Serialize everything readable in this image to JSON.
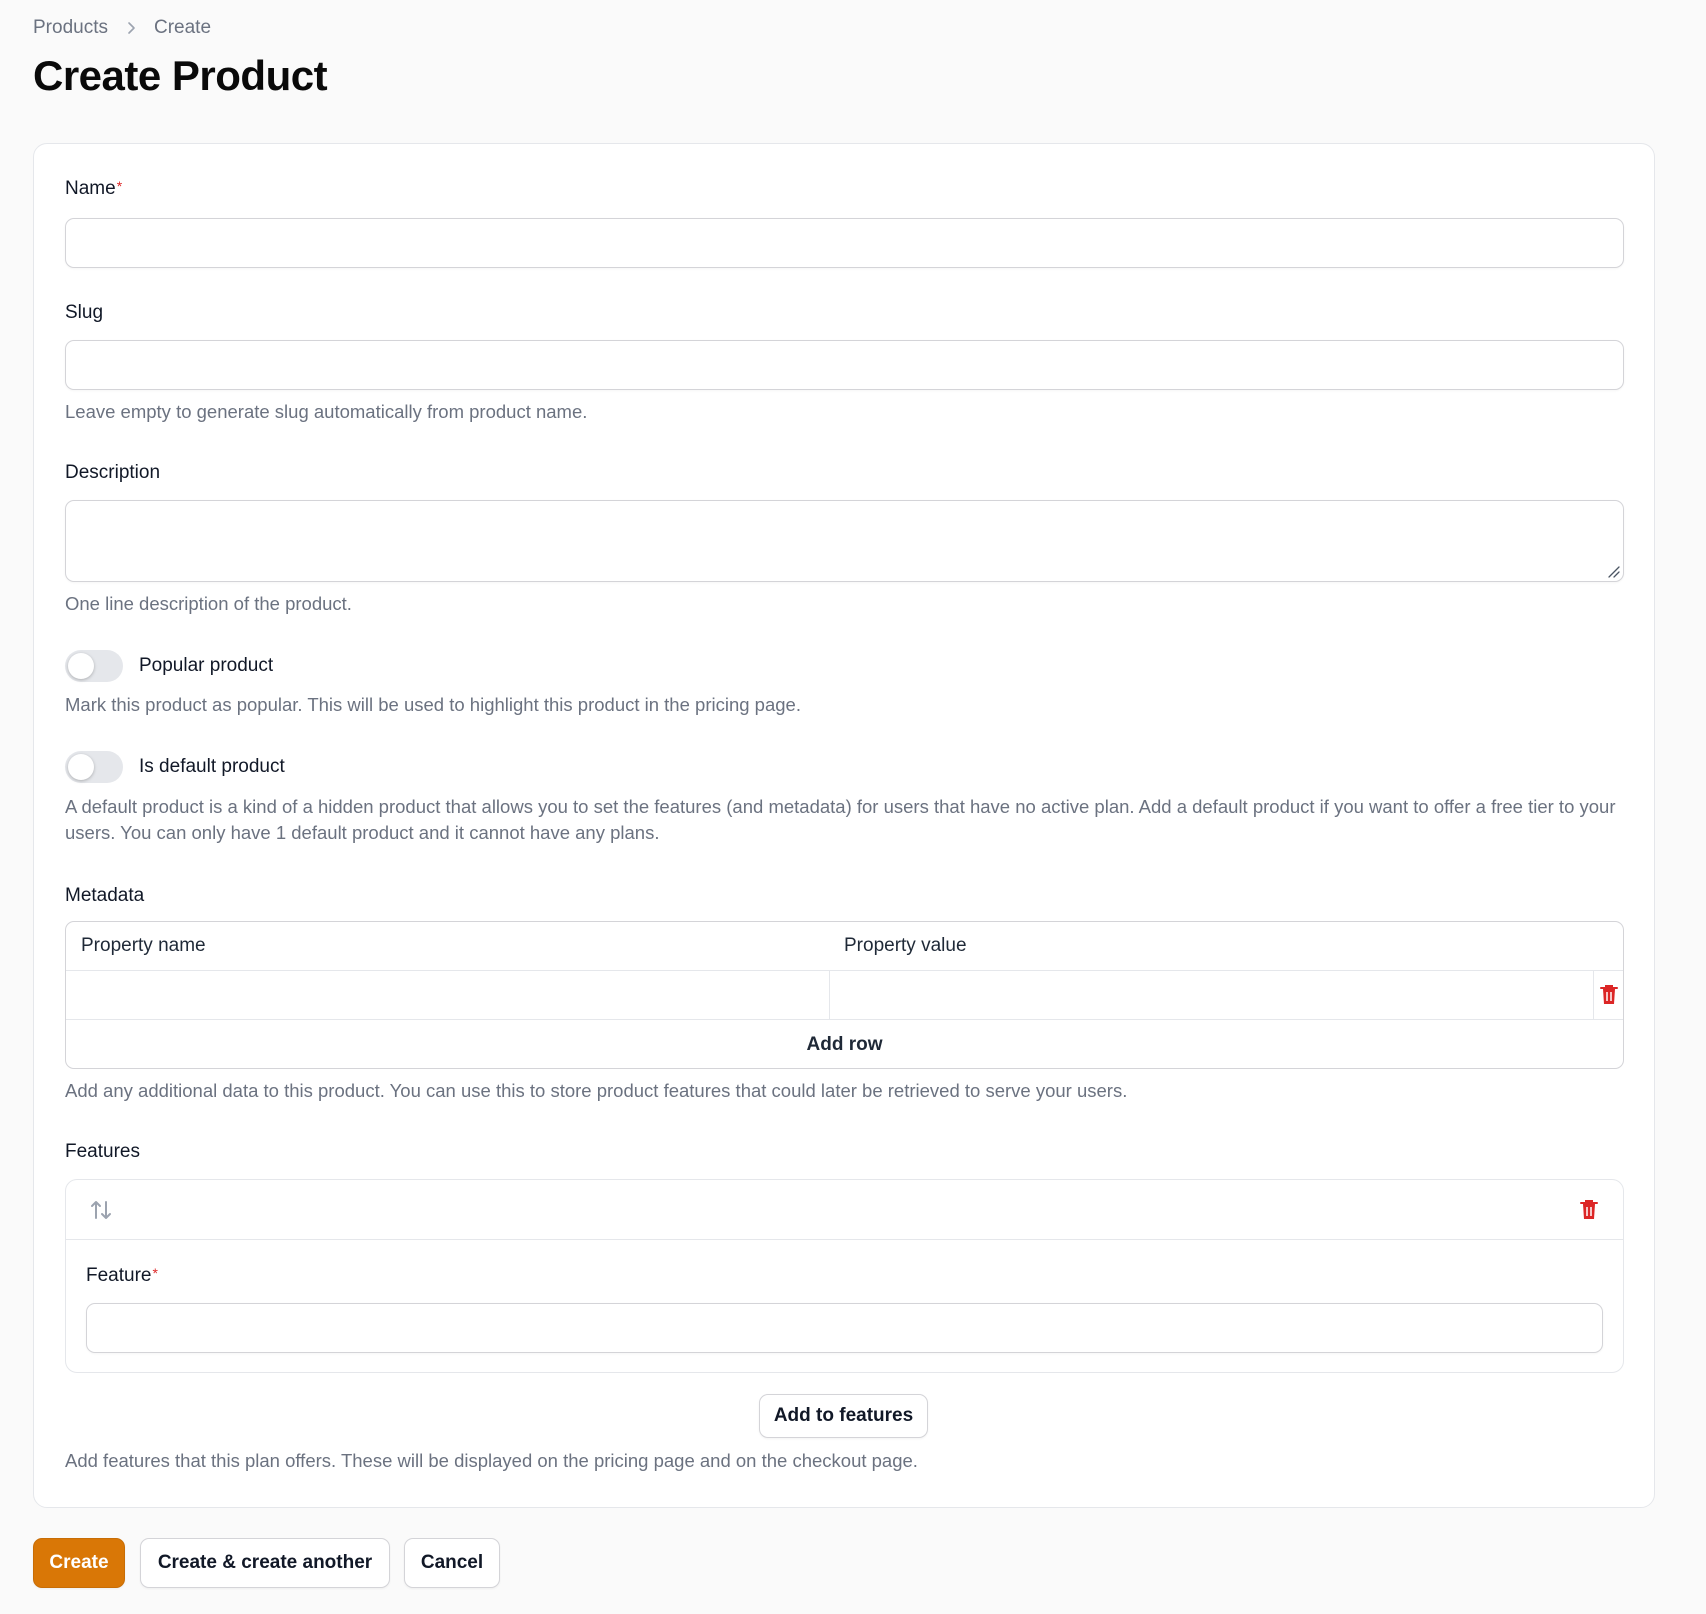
{
  "breadcrumb": {
    "items": [
      "Products",
      "Create"
    ]
  },
  "page": {
    "title": "Create Product"
  },
  "form": {
    "name": {
      "label": "Name",
      "required_mark": "*",
      "value": ""
    },
    "slug": {
      "label": "Slug",
      "value": "",
      "help": "Leave empty to generate slug automatically from product name."
    },
    "description": {
      "label": "Description",
      "value": "",
      "help": "One line description of the product."
    },
    "popular": {
      "label": "Popular product",
      "checked": false,
      "help": "Mark this product as popular. This will be used to highlight this product in the pricing page."
    },
    "is_default": {
      "label": "Is default product",
      "checked": false,
      "help": "A default product is a kind of a hidden product that allows you to set the features (and metadata) for users that have no active plan. Add a default product if you want to offer a free tier to your users. You can only have 1 default product and it cannot have any plans."
    },
    "metadata": {
      "label": "Metadata",
      "columns": [
        "Property name",
        "Property value"
      ],
      "rows": [
        {
          "name": "",
          "value": ""
        }
      ],
      "add_row_label": "Add row",
      "help": "Add any additional data to this product. You can use this to store product features that could later be retrieved to serve your users."
    },
    "features": {
      "label": "Features",
      "item": {
        "label": "Feature",
        "required_mark": "*",
        "value": ""
      },
      "add_label": "Add to features",
      "help": "Add features that this plan offers. These will be displayed on the pricing page and on the checkout page."
    }
  },
  "actions": {
    "create": "Create",
    "create_another": "Create & create another",
    "cancel": "Cancel"
  },
  "colors": {
    "primary": "#d97706",
    "danger": "#dc2626",
    "required": "#dc2626"
  },
  "icons": {
    "breadcrumb_separator": "chevron-right-icon",
    "delete": "trash-icon",
    "reorder": "arrows-up-down-icon",
    "resize": "resize-grip-icon"
  }
}
